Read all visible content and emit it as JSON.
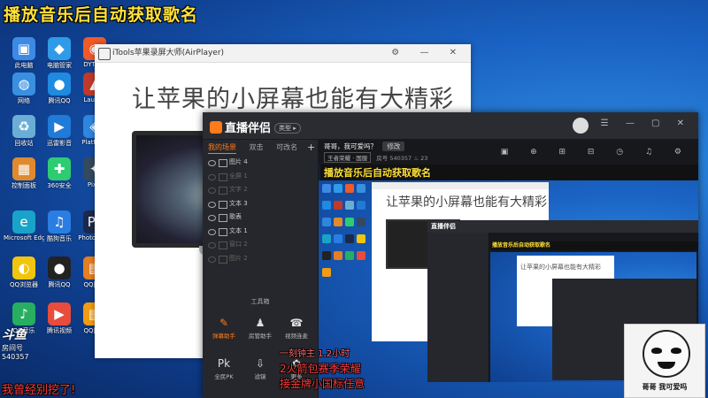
{
  "overlay": {
    "top_title": "播放音乐后自动获取歌名",
    "douyu_logo": "斗鱼",
    "douyu_room_label": "房间号",
    "douyu_room_number": "540357",
    "bottom_left_text": "我曾经别挖了!",
    "red_lines": [
      "一刻钟主 1.2小时",
      "2火箭包赛季荣耀",
      "接金牌小国标任意"
    ],
    "meme_caption": "哥哥  我可爱吗"
  },
  "desktop": {
    "icons": [
      {
        "label": "此电脑",
        "color": "#3c8ae6",
        "glyph": "▣"
      },
      {
        "label": "电脑管家",
        "color": "#2f9be8",
        "glyph": "◆"
      },
      {
        "label": "DYTeES",
        "color": "#f05a28",
        "glyph": "◉"
      },
      {
        "label": "网络",
        "color": "#3a8fe0",
        "glyph": "◍"
      },
      {
        "label": "腾讯QQ",
        "color": "#1e8ae0",
        "glyph": "●"
      },
      {
        "label": "Launch",
        "color": "#c0392b",
        "glyph": "▲"
      },
      {
        "label": "回收站",
        "color": "#6aaed6",
        "glyph": "♻"
      },
      {
        "label": "迅雷影音",
        "color": "#1f7ad8",
        "glyph": "▶"
      },
      {
        "label": "Platform",
        "color": "#2e86de",
        "glyph": "◈"
      },
      {
        "label": "控制面板",
        "color": "#e08a2e",
        "glyph": "▦"
      },
      {
        "label": "360安全",
        "color": "#2ecc71",
        "glyph": "✚"
      },
      {
        "label": "Pixel",
        "color": "#34495e",
        "glyph": "✦"
      },
      {
        "label": "Microsoft Edge",
        "color": "#1aa3c9",
        "glyph": "e"
      },
      {
        "label": "酷狗音乐",
        "color": "#2a7de1",
        "glyph": "♫"
      },
      {
        "label": "PhotoShop",
        "color": "#1b2a4a",
        "glyph": "Ps"
      },
      {
        "label": "QQ浏览器",
        "color": "#f1c40f",
        "glyph": "◐"
      },
      {
        "label": "腾讯QQ",
        "color": "#222",
        "glyph": "●"
      },
      {
        "label": "QQ图片",
        "color": "#e67e22",
        "glyph": "▤"
      },
      {
        "label": "QQ音乐",
        "color": "#27ae60",
        "glyph": "♪"
      },
      {
        "label": "腾讯视频",
        "color": "#e74c3c",
        "glyph": "▶"
      },
      {
        "label": "QQ图片",
        "color": "#f39c12",
        "glyph": "▤"
      }
    ]
  },
  "airplayer": {
    "title": "iTools苹果录屏大师(AirPlayer)",
    "controls": "⚙ — ✕",
    "slogan": "让苹果的小屏幕也能有大精彩"
  },
  "app": {
    "name": "直播伴侣",
    "badge": "类型 ▸",
    "controls": "☰ — ▢ ✕",
    "scene_tabs": [
      "我的场景",
      "双击",
      "可改名"
    ],
    "sources": [
      {
        "label": "图片 4",
        "dim": false
      },
      {
        "label": "全屏 1",
        "dim": true
      },
      {
        "label": "文字 2",
        "dim": true
      },
      {
        "label": "文本 3",
        "dim": false
      },
      {
        "label": "歌表",
        "dim": false
      },
      {
        "label": "文本 1",
        "dim": false
      },
      {
        "label": "窗口 2",
        "dim": true
      },
      {
        "label": "图片 2",
        "dim": true
      }
    ],
    "tools_label": "工具箱",
    "tools": [
      {
        "label": "弹幕助手",
        "glyph": "✎",
        "active": true
      },
      {
        "label": "房管助手",
        "glyph": "♟",
        "active": false
      },
      {
        "label": "视频连麦",
        "glyph": "☎",
        "active": false
      },
      {
        "label": "全民PK",
        "glyph": "Pk",
        "active": false
      },
      {
        "label": "滤镜",
        "glyph": "⇩",
        "active": false
      },
      {
        "label": "更多",
        "glyph": "✿",
        "active": false
      }
    ],
    "room_title": "哥哥，我可爱吗？",
    "room_edit": "修改",
    "room_tag": "王者荣耀 · 国服",
    "room_id_label": "房号",
    "room_id": "540357",
    "heat_count": "23",
    "top_icons": "▣ ⊕ ⊞ ⊟ ◷ ♫ ⚙"
  },
  "preview": {
    "title": "播放音乐后自动获取歌名",
    "slogan": "让苹果的小屏幕也能有大精彩",
    "inner_title": "播放音乐后自动获取歌名",
    "inner_slogan": "让苹果的小屏幕也能有大精彩",
    "inner_app": "直播伴侣"
  },
  "colors": {
    "accent_orange": "#ff7a1a",
    "title_yellow": "#ffe23a",
    "overlay_red": "#ff3b3b"
  }
}
